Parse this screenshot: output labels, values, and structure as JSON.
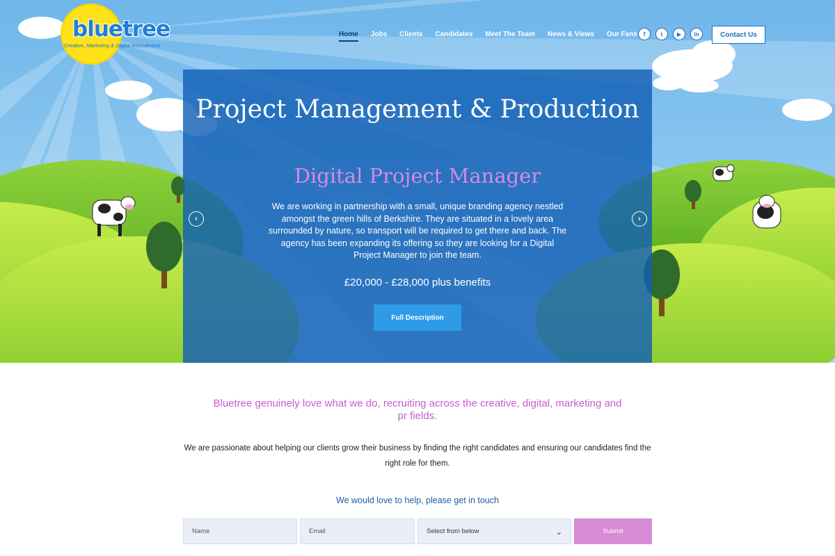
{
  "brand": {
    "name": "bluetree",
    "tagline": "Creative, Marketing & Digital Recruitment"
  },
  "nav": {
    "items": [
      {
        "label": "Home",
        "active": true
      },
      {
        "label": "Jobs",
        "active": false
      },
      {
        "label": "Clients",
        "active": false
      },
      {
        "label": "Candidates",
        "active": false
      },
      {
        "label": "Meet The Team",
        "active": false
      },
      {
        "label": "News & Views",
        "active": false
      },
      {
        "label": "Our Fans",
        "active": false
      }
    ]
  },
  "social": [
    {
      "icon": "facebook-icon",
      "glyph": "f"
    },
    {
      "icon": "twitter-icon",
      "glyph": "t"
    },
    {
      "icon": "youtube-icon",
      "glyph": "▶"
    },
    {
      "icon": "linkedin-icon",
      "glyph": "in"
    }
  ],
  "header": {
    "contact_label": "Contact Us"
  },
  "slide": {
    "heading": "Project Management & Production",
    "subheading": "Digital Project Manager",
    "description": "We are working in partnership with a small, unique branding agency nestled amongst the green hills of Berkshire. They are situated in a lovely area surrounded by nature, so transport will be required to get there and back. The agency has been expanding its offering so they are looking for a Digital Project Manager to join the team.",
    "salary": "£20,000 - £28,000 plus benefits",
    "button_label": "Full Description",
    "prev_icon": "chevron-left-icon",
    "next_icon": "chevron-right-icon"
  },
  "content": {
    "intro": "Bluetree genuinely love what we do, recruiting across the creative, digital, marketing and pr fields.",
    "body": "We are passionate about helping our clients grow their business by finding the right candidates and ensuring our candidates find the right role for them.",
    "touch": "We would love to help, please get in touch"
  },
  "form": {
    "name_placeholder": "Name",
    "email_placeholder": "Email",
    "select_value": "Select from below",
    "submit_label": "Submit"
  },
  "colors": {
    "brand_blue": "#1e6fbf",
    "nav_active": "#0d3c7a",
    "accent_pink": "#c45dcc",
    "slide_panel": "#125fb4",
    "button_blue": "#2f9ae6",
    "submit_pink": "#d68bd4"
  }
}
